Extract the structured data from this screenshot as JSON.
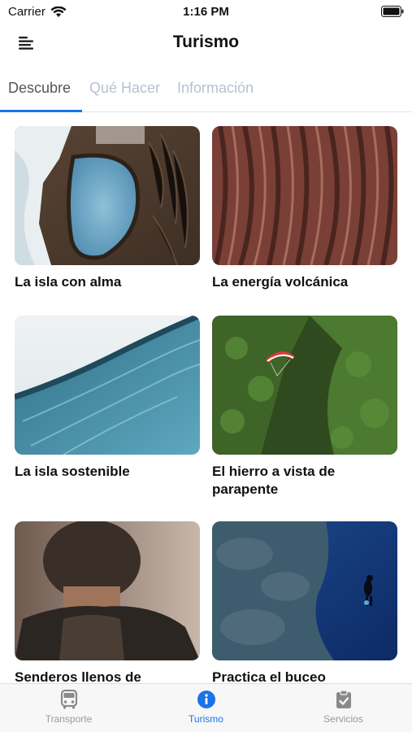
{
  "status": {
    "carrier": "Carrier",
    "time": "1:16 PM"
  },
  "nav": {
    "title": "Turismo"
  },
  "tabs": [
    {
      "label": "Descubre",
      "active": true
    },
    {
      "label": "Qué Hacer",
      "active": false
    },
    {
      "label": "Información",
      "active": false
    }
  ],
  "cards": [
    {
      "title": "La isla con alma"
    },
    {
      "title": "La energía volcánica"
    },
    {
      "title": "La isla sostenible"
    },
    {
      "title": "El hierro a vista de parapente"
    },
    {
      "title": "Senderos llenos de"
    },
    {
      "title": "Practica el buceo"
    }
  ],
  "bottom_tabs": [
    {
      "label": "Transporte",
      "icon": "bus-icon",
      "active": false
    },
    {
      "label": "Turismo",
      "icon": "info-icon",
      "active": true
    },
    {
      "label": "Servicios",
      "icon": "clipboard-check-icon",
      "active": false
    }
  ],
  "colors": {
    "accent": "#1a73e8",
    "inactive_tab": "#b7c0d2"
  }
}
